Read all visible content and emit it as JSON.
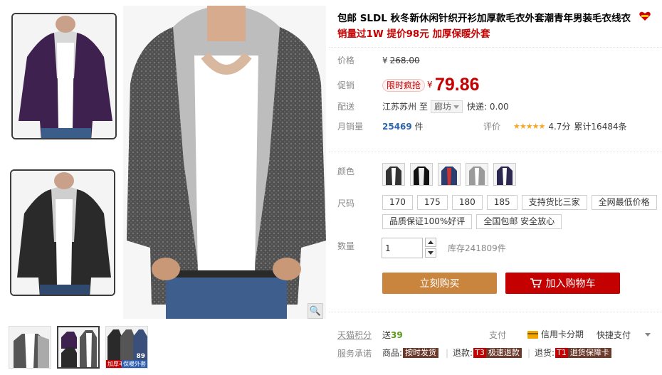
{
  "product": {
    "title": "包邮 SLDL 秋冬新休闲针织开衫加厚款毛衣外套潮青年男装毛衣线衣",
    "subtitle": "销量过1W 提价98元 加厚保暖外套"
  },
  "labels": {
    "price": "价格",
    "promo": "促销",
    "shipping": "配送",
    "monthly_sales": "月销量",
    "color": "颜色",
    "size": "尺码",
    "quantity": "数量",
    "points": "天猫积分",
    "service": "服务承诺"
  },
  "price": {
    "currency": "¥",
    "original": "268.00",
    "promo_tag": "限时疯抢",
    "current": "79.86",
    "accent_color": "#c40000"
  },
  "shipping": {
    "origin": "江苏苏州",
    "to": "至",
    "destination": "廊坊",
    "fee": "快递: 0.00"
  },
  "sales": {
    "count": "25469",
    "unit": "件"
  },
  "rating": {
    "label": "评价",
    "stars": "★★★★★",
    "score": "4.7分",
    "comments": "累计16484条"
  },
  "colors": [
    {
      "name": "black-hood-white",
      "icon": "sweater-swatch"
    },
    {
      "name": "black-white-stripe",
      "icon": "sweater-swatch"
    },
    {
      "name": "navy",
      "icon": "sweater-swatch"
    },
    {
      "name": "grey",
      "icon": "sweater-swatch"
    },
    {
      "name": "purple",
      "icon": "sweater-swatch"
    }
  ],
  "sizes": [
    "170",
    "175",
    "180",
    "185",
    "支持货比三家",
    "全网最低价格"
  ],
  "sizes_row2": [
    "品质保证100%好评",
    "全国包邮 安全放心"
  ],
  "quantity": {
    "value": "1",
    "stock": "库存241809件"
  },
  "buttons": {
    "buy": "立刻购买",
    "cart": "加入购物车"
  },
  "points": {
    "prefix": "送",
    "value": "39"
  },
  "payment": {
    "label": "支付",
    "card": "信用卡分期",
    "quick": "快捷支付"
  },
  "services": [
    {
      "key": "商品:",
      "code": "",
      "tag": "按时发货"
    },
    {
      "key": "退款:",
      "code": "T3",
      "tag": "极速退款"
    },
    {
      "key": "退货:",
      "code": "T1",
      "tag": "退货保障卡"
    }
  ],
  "thumbs": {
    "tag1": "加厚毛衣",
    "tag2": "保暖外套",
    "num": "89"
  }
}
